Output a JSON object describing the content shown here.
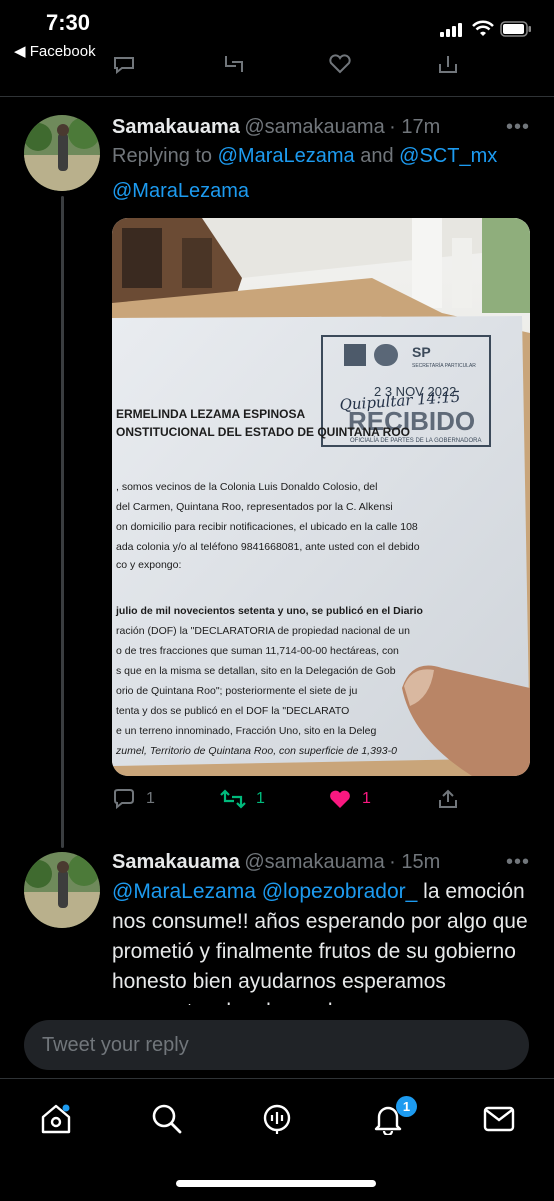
{
  "status_bar": {
    "time": "7:30",
    "back_app": "◀ Facebook"
  },
  "tweet1": {
    "display_name": "Samakauama",
    "handle": "@samakauama",
    "time_ago": "· 17m",
    "more": "•••",
    "replying_prefix": "Replying to ",
    "replying_user1": "@MaraLezama",
    "replying_and": " and ",
    "replying_user2": "@SCT_mx",
    "body_mention": "@MaraLezama",
    "photo_alt": "Photo of a document stamped RECIBIDO",
    "stamp": {
      "org": "SP",
      "sub": "SECRETARÍA PARTICULAR",
      "date": "2 3 NOV 2022",
      "handwritten": "Quipultar 14:15",
      "received": "RECIBIDO",
      "office": "OFICIALÍA DE PARTES DE LA GOBERNADORA"
    },
    "document_lines": [
      "ERMELINDA LEZAMA ESPINOSA",
      "ONSTITUCIONAL DEL ESTADO DE QUINTANA ROO",
      ", somos vecinos de la Colonia Luis Donaldo Colosio, del",
      "del Carmen, Quintana Roo, representados por la C. Alkensi",
      "on domicilio para recibir notificaciones, el ubicado en la calle 108",
      "ada colonia y/o al teléfono 9841668081, ante usted con el debido",
      "co y expongo:",
      "julio de mil novecientos setenta y uno, se publicó en el Diario",
      "ración (DOF) la \"DECLARATORIA de propiedad nacional de un",
      "o de tres fracciones que suman 11,714-00-00 hectáreas, con",
      "s que en la misma se detallan, sito en la Delegación de Gob",
      "orio de Quintana Roo\"; posteriormente el siete de ju",
      "tenta y dos se publicó en el DOF la \"DECLARATO",
      "e un terreno innominado, Fracción Uno, sito en la Deleg",
      "zumel, Territorio de Quintana Roo, con superficie de 1,393-0"
    ],
    "reply_count": "1",
    "retweet_count": "1",
    "like_count": "1"
  },
  "tweet2": {
    "display_name": "Samakauama",
    "handle": "@samakauama",
    "time_ago": "· 15m",
    "more": "•••",
    "mention1": "@MaraLezama",
    "mention2": "@lopezobrador_",
    "text_rest": " la emoción nos consume!! años esperando por algo que prometió y finalmente frutos de su gobierno honesto bien ayudarnos esperamos respuesta y les damos las"
  },
  "composer": {
    "placeholder": "Tweet your reply"
  },
  "tabbar": {
    "notifications_badge": "1"
  },
  "colors": {
    "accent": "#1d9bf0",
    "retweet": "#00ba7c",
    "like": "#f91880",
    "muted": "#71767b"
  }
}
